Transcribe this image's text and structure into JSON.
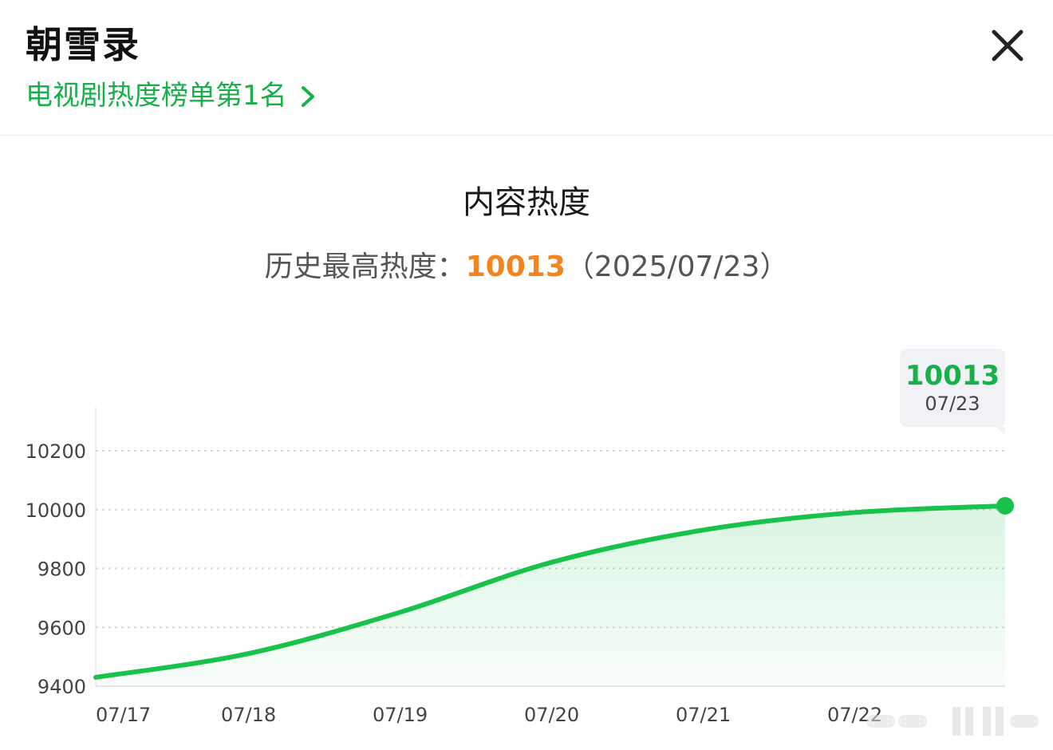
{
  "header": {
    "title": "朝雪录",
    "rank_link": "电视剧热度榜单第1名"
  },
  "section": {
    "title": "内容热度",
    "history_label": "历史最高热度：",
    "history_value": "10013",
    "history_date": "（2025/07/23）"
  },
  "tooltip": {
    "value": "10013",
    "date": "07/23"
  },
  "colors": {
    "accent_green": "#18b04a",
    "peak_orange": "#f5841f",
    "line_green": "#19c24a"
  },
  "chart_data": {
    "type": "area",
    "x": [
      "07/17",
      "07/18",
      "07/19",
      "07/20",
      "07/21",
      "07/22",
      "07/23"
    ],
    "x_tick_labels": [
      "07/17",
      "07/18",
      "07/19",
      "07/20",
      "07/21",
      "07/22",
      ""
    ],
    "values": [
      9430,
      9510,
      9650,
      9820,
      9930,
      9990,
      10013
    ],
    "y_ticks": [
      9400,
      9600,
      9800,
      10000,
      10200
    ],
    "ylim": [
      9400,
      10200
    ],
    "grid": true,
    "highlight_index": 6
  }
}
